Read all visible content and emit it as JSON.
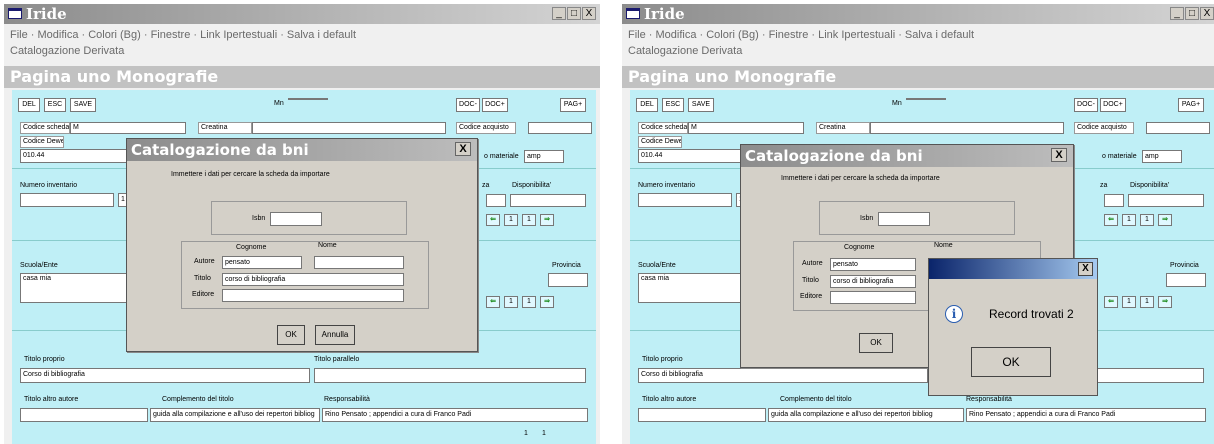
{
  "app": {
    "title": "Iride",
    "controls": {
      "minimize": "_",
      "maximize": "□",
      "close": "X"
    }
  },
  "menu": {
    "line1": "File · Modifica · Colori (Bg) · Finestre · Link Ipertestuali · Salva i default",
    "line2": "Catalogazione Derivata"
  },
  "page": {
    "title": "Pagina uno Monografie"
  },
  "toolbar": {
    "del": "DEL",
    "esc": "ESC",
    "save": "SAVE",
    "mn": "Mn",
    "doc_minus": "DOC-",
    "doc_plus": "DOC+",
    "pag_plus": "PAG+"
  },
  "form": {
    "codice_scheda_label": "Codice scheda",
    "codice_scheda_value": "M",
    "creatina_label": "Creatina",
    "codice_acquisto_label": "Codice acquisto",
    "codice_dewey_label": "Codice Dewey",
    "dewey_value": "010.44",
    "tipo_materiale_label": "o materiale",
    "tipo_materiale_value": "amp",
    "numero_inventario_label": "Numero inventario",
    "inventario_value": "1",
    "za_label": "za",
    "disponibilita_label": "Disponibilita'",
    "nav_left": "⇐",
    "nav_one": "1",
    "nav_one2": "1",
    "nav_right": "⇒",
    "scuola_label": "Scuola/Ente",
    "scuola_value": "casa mia",
    "provincia_label": "Provincia",
    "titolo_proprio_label": "Titolo proprio",
    "titolo_parallelo_label": "Titolo parallelo",
    "titolo_proprio_value": "Corso di bibliografia",
    "titolo_altro_label": "Titolo altro autore",
    "complemento_label": "Complemento del titolo",
    "responsabilita_label": "Responsabilità",
    "complemento_value": "guida alla compilazione e all'uso dei repertori bibliog",
    "responsabilita_value": "Rino Pensato ; appendici a cura di Franco Padi",
    "footer_left": "1",
    "footer_right": "1"
  },
  "dialog": {
    "title": "Catalogazione da bni",
    "close": "X",
    "instruction": "Immettere i dati per cercare la scheda da importare",
    "isbn_label": "Isbn",
    "cognome_label": "Cognome",
    "nome_label": "Nome",
    "autore_label": "Autore",
    "autore_value": "pensato",
    "titolo_label": "Titolo",
    "titolo_value_left": "corso di bibliografia",
    "titolo_value_right": "corso di bibliografia",
    "editore_label": "Editore",
    "ok": "OK",
    "annulla": "Annulla"
  },
  "message": {
    "close": "X",
    "text": "Record trovati 2",
    "ok": "OK",
    "icon": "info-icon"
  }
}
